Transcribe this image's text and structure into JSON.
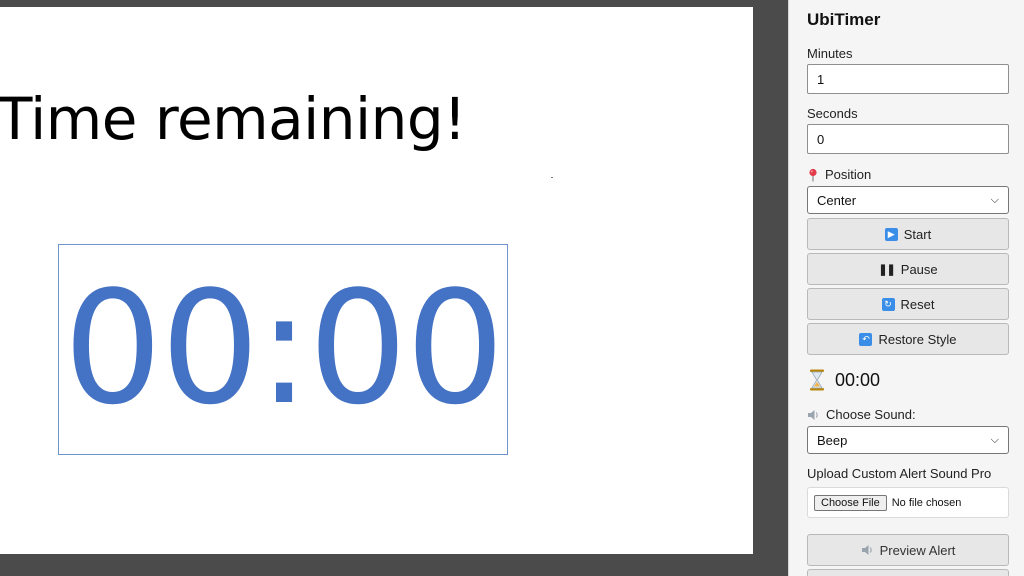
{
  "slide": {
    "title": "Time remaining!",
    "timer_display": "00:00"
  },
  "pane": {
    "title": "UbiTimer",
    "minutes_label": "Minutes",
    "minutes_value": "1",
    "seconds_label": "Seconds",
    "seconds_value": "0",
    "position_label": "Position",
    "position_value": "Center",
    "start_label": "Start",
    "pause_label": "Pause",
    "reset_label": "Reset",
    "restore_label": "Restore Style",
    "status_time": "00:00",
    "sound_label": "Choose Sound:",
    "sound_value": "Beep",
    "upload_label": "Upload Custom Alert Sound Pro",
    "choose_file_label": "Choose File",
    "no_file_text": "No file chosen",
    "preview_label": "Preview Alert"
  },
  "colors": {
    "timer_text": "#4472c4",
    "accent_icon": "#3b8ee8"
  },
  "icons": {
    "position": "pushpin-icon",
    "start": "play-icon",
    "pause": "pause-icon",
    "reset": "repeat-icon",
    "restore": "undo-icon",
    "status": "hourglass-icon",
    "sound": "speaker-icon",
    "preview": "speaker-icon"
  }
}
